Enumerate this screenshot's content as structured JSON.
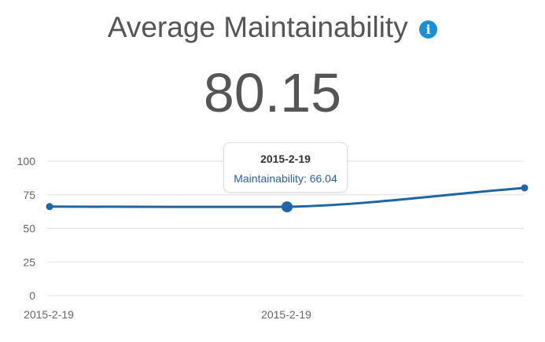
{
  "header": {
    "title": "Average Maintainability",
    "info_icon": "info-icon",
    "info_icon_glyph": "i",
    "info_color": "#1a8fd6"
  },
  "kpi": {
    "value": "80.15"
  },
  "tooltip": {
    "date": "2015-2-19",
    "series_label": "Maintainability: 66.04",
    "text_color": "#2a5f9e"
  },
  "colors": {
    "series": "#1f64a5",
    "grid": "#e0e0e0",
    "axis_text": "#666666"
  },
  "chart_data": {
    "type": "line",
    "x": [
      "2015-2-19",
      "2015-2-19",
      "2015-2-19"
    ],
    "x_tick_labels": [
      "2015-2-19",
      "2015-2-19"
    ],
    "y_ticks": [
      0,
      25,
      50,
      75,
      100
    ],
    "ylim": [
      0,
      100
    ],
    "grid": true,
    "series": [
      {
        "values": [
          66.2,
          66.04,
          80.15
        ],
        "highlighted_index": 1
      }
    ]
  }
}
